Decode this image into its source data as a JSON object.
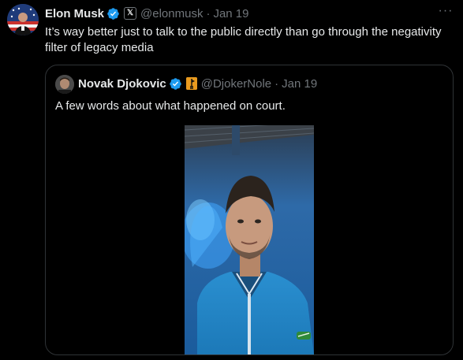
{
  "tweet": {
    "author_name": "Elon Musk",
    "handle": "@elonmusk",
    "separator": "·",
    "time": "Jan 19",
    "more_label": "···",
    "affiliate_badge": "𝕏",
    "text": "It’s way better just to talk to the public directly than go through the negativity filter of legacy media"
  },
  "quoted": {
    "author_name": "Novak Djokovic",
    "handle": "@DjokerNole",
    "separator": "·",
    "time": "Jan 19",
    "text": "A few words about what happened on court."
  },
  "icons": {
    "verified": "verified-check-icon",
    "affiliate": "x-affiliate-badge-icon",
    "flag": "flag-badge-icon"
  },
  "colors": {
    "background": "#000000",
    "text": "#e7e9ea",
    "secondary": "#71767b",
    "verified": "#1d9bf0",
    "border": "#2f3336"
  }
}
